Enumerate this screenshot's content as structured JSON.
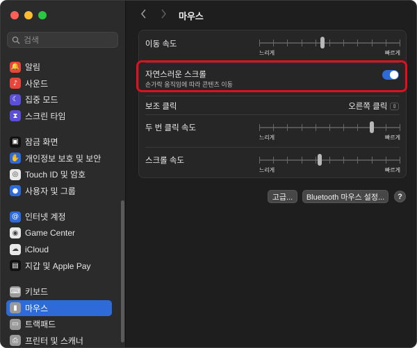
{
  "colors": {
    "accent": "#2f6bd8",
    "highlight": "#e0101e"
  },
  "search": {
    "placeholder": "검색"
  },
  "sidebar": {
    "groups": [
      [
        {
          "label": "알림",
          "icon": "bell-icon",
          "color": "#e8453c"
        },
        {
          "label": "사운드",
          "icon": "speaker-icon",
          "color": "#e8453c"
        },
        {
          "label": "집중 모드",
          "icon": "moon-icon",
          "color": "#5b4fd6"
        },
        {
          "label": "스크린 타임",
          "icon": "hourglass-icon",
          "color": "#5b4fd6"
        }
      ],
      [
        {
          "label": "잠금 화면",
          "icon": "lock-icon",
          "color": "#111111"
        },
        {
          "label": "개인정보 보호 및 보안",
          "icon": "hand-icon",
          "color": "#2f6bd8"
        },
        {
          "label": "Touch ID 및 암호",
          "icon": "fingerprint-icon",
          "color": "#e9e9e9"
        },
        {
          "label": "사용자 및 그룹",
          "icon": "users-icon",
          "color": "#2f6bd8"
        }
      ],
      [
        {
          "label": "인터넷 계정",
          "icon": "at-icon",
          "color": "#2f6bd8"
        },
        {
          "label": "Game Center",
          "icon": "gamecenter-icon",
          "color": "#e9e9e9"
        },
        {
          "label": "iCloud",
          "icon": "cloud-icon",
          "color": "#e9e9e9"
        },
        {
          "label": "지갑 및 Apple Pay",
          "icon": "wallet-icon",
          "color": "#111111"
        }
      ],
      [
        {
          "label": "키보드",
          "icon": "keyboard-icon",
          "color": "#9a9a9a"
        },
        {
          "label": "마우스",
          "icon": "mouse-icon",
          "color": "#9a9a9a",
          "active": true
        },
        {
          "label": "트랙패드",
          "icon": "trackpad-icon",
          "color": "#9a9a9a"
        },
        {
          "label": "프린터 및 스캐너",
          "icon": "printer-icon",
          "color": "#9a9a9a"
        }
      ]
    ]
  },
  "toolbar": {
    "title": "마우스",
    "back_icon": "chevron-left-icon",
    "forward_icon": "chevron-right-icon"
  },
  "settings": {
    "tracking_speed": {
      "label": "이동 속도",
      "lo": "느리게",
      "hi": "빠르게",
      "level": 0.45
    },
    "natural_scroll": {
      "label": "자연스러운 스크롤",
      "description": "손가락 움직임에 따라 콘텐츠 이동",
      "on": true
    },
    "secondary_click": {
      "label": "보조 클릭",
      "value": "오른쪽 클릭"
    },
    "double_click_speed": {
      "label": "두 번 클릭 속도",
      "lo": "느리게",
      "hi": "빠르게",
      "level": 0.8
    },
    "scroll_speed": {
      "label": "스크롤 속도",
      "lo": "느리게",
      "hi": "빠르게",
      "level": 0.43
    }
  },
  "buttons": {
    "advanced": "고급...",
    "bluetooth": "Bluetooth 마우스 설정...",
    "help": "?"
  }
}
